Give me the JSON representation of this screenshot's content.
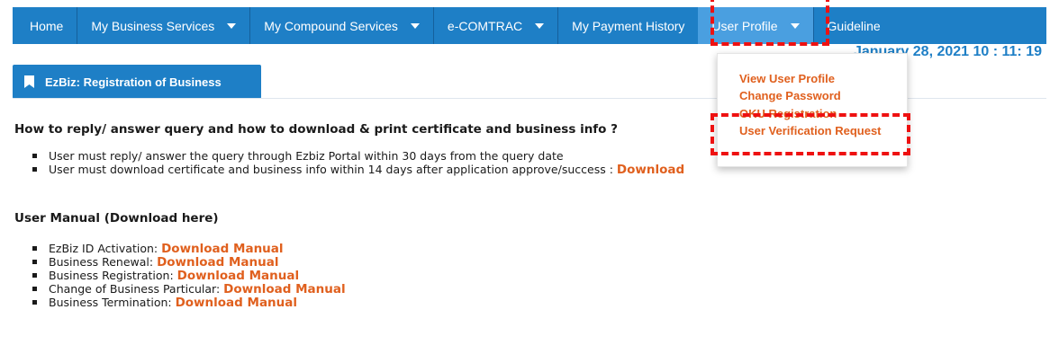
{
  "navbar": {
    "items": [
      {
        "label": "Home"
      },
      {
        "label": "My Business Services",
        "dropdown": true
      },
      {
        "label": "My Compound Services",
        "dropdown": true
      },
      {
        "label": "e-COMTRAC",
        "dropdown": true
      },
      {
        "label": "My Payment History"
      },
      {
        "label": "User Profile",
        "dropdown": true,
        "active": true
      },
      {
        "label": "Guideline"
      }
    ]
  },
  "datetime": "January 28, 2021 10 : 11: 19",
  "user_profile_menu": {
    "items": [
      "View User Profile",
      "Change Password",
      "OKU Registration",
      "User Verification Request"
    ]
  },
  "panel": {
    "icon": "bookmark-icon",
    "title": "EzBiz: Registration of Business"
  },
  "query_section": {
    "title": "How to reply/ answer query and how to download & print certificate and business info ?",
    "bullets": [
      {
        "text": "User must reply/ answer the query through Ezbiz Portal within 30 days from the query date"
      },
      {
        "text": "User must download certificate and business info within 14 days after application approve/success : ",
        "link": "Download"
      }
    ]
  },
  "manual_section": {
    "title": "User Manual (Download here)",
    "items": [
      {
        "text": "EzBiz ID Activation: ",
        "link": "Download Manual"
      },
      {
        "text": "Business Renewal: ",
        "link": "Download Manual"
      },
      {
        "text": "Business Registration: ",
        "link": "Download Manual"
      },
      {
        "text": "Change of Business Particular: ",
        "link": "Download Manual"
      },
      {
        "text": "Business Termination: ",
        "link": "Download Manual"
      }
    ]
  },
  "colors": {
    "nav_bg": "#1e7fc6",
    "nav_active": "#4a9fe0",
    "link_orange": "#e0601e",
    "highlight_red": "#ee1111"
  }
}
